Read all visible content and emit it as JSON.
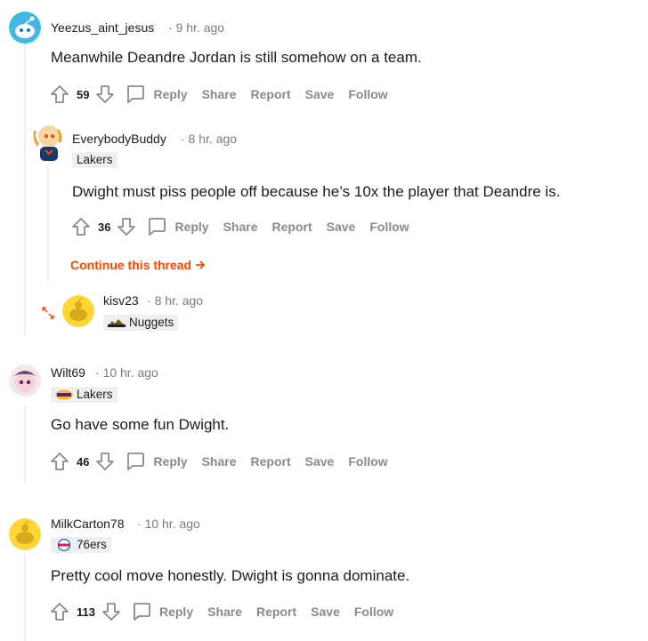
{
  "comments": [
    {
      "username": "Yeezus_aint_jesus",
      "time": "9 hr. ago",
      "body": "Meanwhile Deandre Jordan is still somehow on a team.",
      "score": "59",
      "actions": {
        "reply": "Reply",
        "share": "Share",
        "report": "Report",
        "save": "Save",
        "follow": "Follow"
      }
    },
    {
      "username": "EverybodyBuddy",
      "time": "8 hr. ago",
      "flair": "Lakers",
      "body": "Dwight must piss people off because he’s 10x the player that Deandre is.",
      "score": "36",
      "actions": {
        "reply": "Reply",
        "share": "Share",
        "report": "Report",
        "save": "Save",
        "follow": "Follow"
      },
      "continue_thread": "Continue this thread"
    },
    {
      "username": "kisv23",
      "time": "8 hr. ago",
      "flair": "Nuggets"
    },
    {
      "username": "Wilt69",
      "time": "10 hr. ago",
      "flair": "Lakers",
      "body": "Go have some fun Dwight.",
      "score": "46",
      "actions": {
        "reply": "Reply",
        "share": "Share",
        "report": "Report",
        "save": "Save",
        "follow": "Follow"
      }
    },
    {
      "username": "MilkCarton78",
      "time": "10 hr. ago",
      "flair": "76ers",
      "body": "Pretty cool move honestly. Dwight is gonna dominate.",
      "score": "113",
      "actions": {
        "reply": "Reply",
        "share": "Share",
        "report": "Report",
        "save": "Save",
        "follow": "Follow"
      }
    }
  ],
  "separator": "·",
  "colors": {
    "accent": "#ff4500",
    "meta": "#7c7c7c",
    "action": "#878a8c",
    "thread_line": "#edeff1",
    "flair_bg": "#edeff1"
  }
}
